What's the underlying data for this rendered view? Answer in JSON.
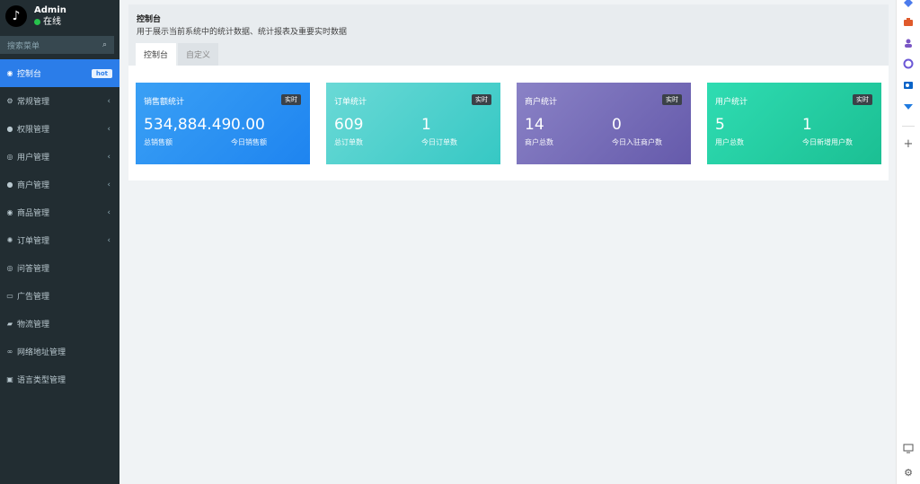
{
  "user": {
    "name": "Admin",
    "status": "在线",
    "avatar_glyph": "♪"
  },
  "search": {
    "placeholder": "搜索菜单"
  },
  "menu": [
    {
      "label": "控制台",
      "icon": "dashboard-icon",
      "glyph": "◉",
      "active": true,
      "badge": "hot"
    },
    {
      "label": "常规管理",
      "icon": "cogs-icon",
      "glyph": "⚙",
      "chevron": true
    },
    {
      "label": "权限管理",
      "icon": "group-icon",
      "glyph": "●",
      "chevron": true
    },
    {
      "label": "用户管理",
      "icon": "user-icon",
      "glyph": "◎",
      "chevron": true
    },
    {
      "label": "商户管理",
      "icon": "apple-icon",
      "glyph": "●",
      "chevron": true
    },
    {
      "label": "商品管理",
      "icon": "product-icon",
      "glyph": "◉",
      "chevron": true
    },
    {
      "label": "订单管理",
      "icon": "order-icon",
      "glyph": "✺",
      "chevron": true
    },
    {
      "label": "问答管理",
      "icon": "question-icon",
      "glyph": "◎"
    },
    {
      "label": "广告管理",
      "icon": "ad-icon",
      "glyph": "▭"
    },
    {
      "label": "物流管理",
      "icon": "truck-icon",
      "glyph": "▰"
    },
    {
      "label": "网络地址管理",
      "icon": "link-icon",
      "glyph": "∞"
    },
    {
      "label": "语言类型管理",
      "icon": "language-icon",
      "glyph": "▣"
    }
  ],
  "header": {
    "title": "控制台",
    "description": "用于展示当前系统中的统计数据、统计报表及重要实时数据",
    "tabs": [
      "控制台",
      "自定义"
    ]
  },
  "cards": [
    {
      "title": "销售额统计",
      "badge": "实时",
      "stats": [
        {
          "value": "534,884.49",
          "label": "总销售额"
        },
        {
          "value": "0.00",
          "label": "今日销售额"
        }
      ]
    },
    {
      "title": "订单统计",
      "badge": "实时",
      "stats": [
        {
          "value": "609",
          "label": "总订单数"
        },
        {
          "value": "1",
          "label": "今日订单数"
        }
      ]
    },
    {
      "title": "商户统计",
      "badge": "实时",
      "stats": [
        {
          "value": "14",
          "label": "商户总数"
        },
        {
          "value": "0",
          "label": "今日入驻商户数"
        }
      ]
    },
    {
      "title": "用户统计",
      "badge": "实时",
      "stats": [
        {
          "value": "5",
          "label": "用户总数"
        },
        {
          "value": "1",
          "label": "今日新增用户数"
        }
      ]
    }
  ],
  "right_toolbar": {
    "items": [
      "diamond-icon",
      "briefcase-icon",
      "person-icon",
      "sync-icon",
      "outlook-icon",
      "bookmark-icon",
      "plus-icon",
      "screen-icon",
      "settings-icon"
    ],
    "plus_glyph": "+",
    "settings_glyph": "⚙"
  }
}
